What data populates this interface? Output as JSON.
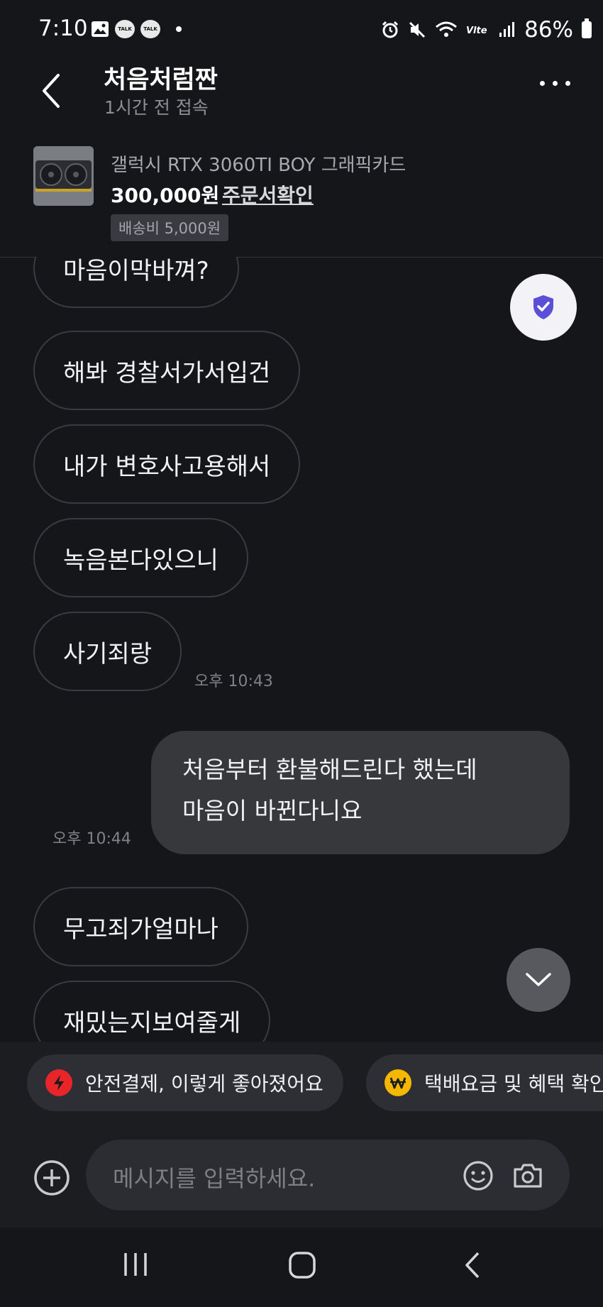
{
  "status_bar": {
    "time": "7:10",
    "battery": "86%",
    "talk_label": "TALK"
  },
  "header": {
    "title": "처음처럼짠",
    "subtitle": "1시간 전 접속"
  },
  "product": {
    "title": "갤럭시 RTX 3060TI BOY 그래픽카드",
    "price": "300,000원",
    "order_link": "주문서확인",
    "shipping": "배송비 5,000원"
  },
  "messages": [
    {
      "text": "마음이막바껴?"
    },
    {
      "text": "해봐 경찰서가서입건"
    },
    {
      "text": "내가 변호사고용해서"
    },
    {
      "text": "녹음본다있으니"
    },
    {
      "text": "사기죄랑",
      "time": "오후 10:43"
    },
    {
      "text_line1": "처음부터 환불해드린다 했는데",
      "text_line2": "마음이 바뀐다니요",
      "time": "오후 10:44"
    },
    {
      "text": "무고죄가얼마나"
    },
    {
      "text": "재밌는지보여줄게"
    }
  ],
  "quick_actions": [
    {
      "label": "안전결제, 이렇게 좋아졌어요",
      "icon": "lightning-icon",
      "color": "#e8262a"
    },
    {
      "label": "택배요금 및 혜택 확인",
      "icon": "won-icon",
      "color": "#f5b700"
    }
  ],
  "composer": {
    "placeholder": "메시지를 입력하세요."
  },
  "colors": {
    "background": "#151619",
    "bubble_out": "#37383c",
    "shield": "#5a4fd6"
  }
}
